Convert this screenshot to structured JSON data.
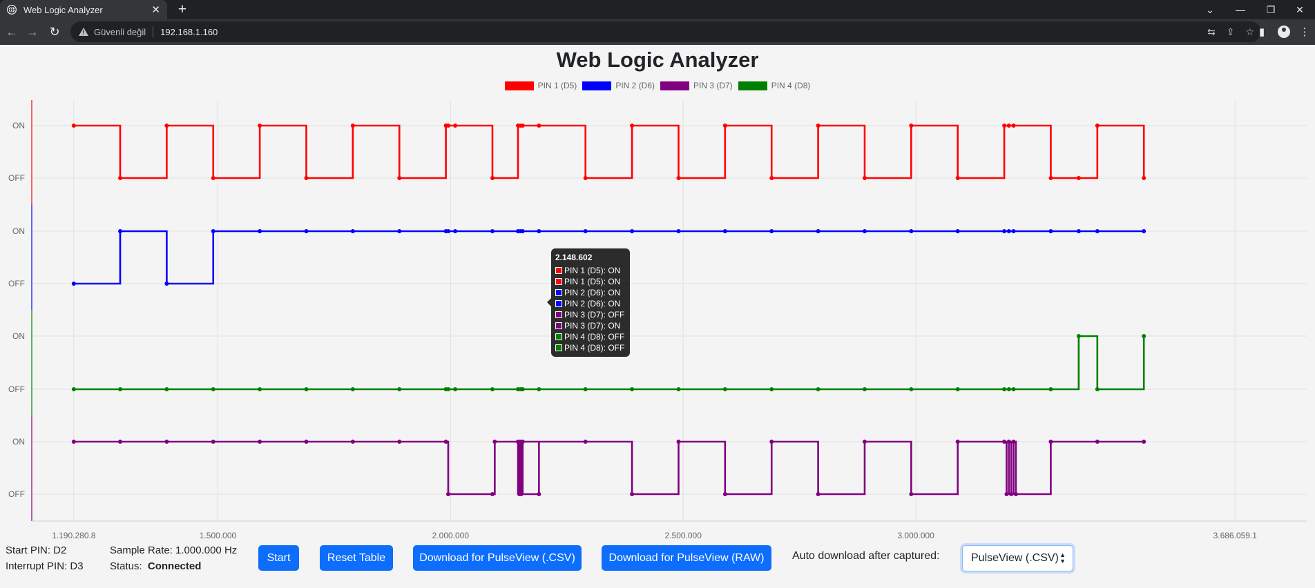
{
  "browser": {
    "tab_title": "Web Logic Analyzer",
    "not_secure_label": "Güvenli değil",
    "url": "192.168.1.160"
  },
  "page": {
    "title": "Web Logic Analyzer"
  },
  "legend": [
    {
      "label": "PIN 1 (D5)",
      "color": "#ff0000"
    },
    {
      "label": "PIN 2 (D6)",
      "color": "#0000ff"
    },
    {
      "label": "PIN 3 (D7)",
      "color": "#800080"
    },
    {
      "label": "PIN 4 (D8)",
      "color": "#008000"
    }
  ],
  "chart_data": {
    "type": "line",
    "stepped": true,
    "grid": true,
    "x_domain": [
      1100000,
      3840000
    ],
    "x_ticks": [
      {
        "value": 1190280.8,
        "label": "1.190.280,8"
      },
      {
        "value": 1500000,
        "label": "1.500.000"
      },
      {
        "value": 2000000,
        "label": "2.000.000"
      },
      {
        "value": 2500000,
        "label": "2.500.000"
      },
      {
        "value": 3000000,
        "label": "3.000.000"
      },
      {
        "value": 3686059.1,
        "label": "3.686.059,1"
      }
    ],
    "y_labels": [
      "ON",
      "OFF",
      "ON",
      "OFF",
      "ON",
      "OFF",
      "ON",
      "OFF"
    ],
    "series": [
      {
        "name": "PIN 1 (D5)",
        "color": "#ff0000",
        "lane": 0,
        "x": [
          1190281,
          1290000,
          1390000,
          1490000,
          1590000,
          1690000,
          1790000,
          1890000,
          1990000,
          1995000,
          2010000,
          2090000,
          2145000,
          2150000,
          2155000,
          2190000,
          2290000,
          2390000,
          2490000,
          2590000,
          2690000,
          2790000,
          2890000,
          2990000,
          3090000,
          3190000,
          3200000,
          3210000,
          3290000,
          3350000,
          3390000,
          3490000
        ],
        "y": [
          1,
          0,
          1,
          0,
          1,
          0,
          1,
          0,
          1,
          1,
          1,
          0,
          1,
          1,
          1,
          1,
          0,
          1,
          0,
          1,
          0,
          1,
          0,
          1,
          0,
          1,
          1,
          1,
          0,
          0,
          1,
          0
        ]
      },
      {
        "name": "PIN 2 (D6)",
        "color": "#0000ff",
        "lane": 1,
        "x": [
          1190281,
          1290000,
          1390000,
          1490000,
          1590000,
          1690000,
          1790000,
          1890000,
          1990000,
          1995000,
          2010000,
          2090000,
          2145000,
          2150000,
          2155000,
          2190000,
          2290000,
          2390000,
          2490000,
          2590000,
          2690000,
          2790000,
          2890000,
          2990000,
          3090000,
          3190000,
          3200000,
          3210000,
          3290000,
          3350000,
          3390000,
          3490000
        ],
        "y": [
          0,
          1,
          0,
          1,
          1,
          1,
          1,
          1,
          1,
          1,
          1,
          1,
          1,
          1,
          1,
          1,
          1,
          1,
          1,
          1,
          1,
          1,
          1,
          1,
          1,
          1,
          1,
          1,
          1,
          1,
          1,
          1
        ]
      },
      {
        "name": "PIN 4 (D8)",
        "color": "#008000",
        "lane": 2,
        "x": [
          1190281,
          1290000,
          1390000,
          1490000,
          1590000,
          1690000,
          1790000,
          1890000,
          1990000,
          1995000,
          2010000,
          2090000,
          2145000,
          2150000,
          2155000,
          2190000,
          2290000,
          2390000,
          2490000,
          2590000,
          2690000,
          2790000,
          2890000,
          2990000,
          3090000,
          3190000,
          3200000,
          3210000,
          3290000,
          3350000,
          3390000,
          3490000
        ],
        "y": [
          0,
          0,
          0,
          0,
          0,
          0,
          0,
          0,
          0,
          0,
          0,
          0,
          0,
          0,
          0,
          0,
          0,
          0,
          0,
          0,
          0,
          0,
          0,
          0,
          0,
          0,
          0,
          0,
          0,
          1,
          0,
          1
        ]
      },
      {
        "name": "PIN 3 (D7)",
        "color": "#800080",
        "lane": 3,
        "x": [
          1190281,
          1290000,
          1390000,
          1490000,
          1590000,
          1690000,
          1790000,
          1890000,
          1990000,
          1995000,
          2090000,
          2095000,
          2190000,
          2145000,
          2148000,
          2150000,
          2152000,
          2155000,
          2290000,
          2390000,
          2490000,
          2590000,
          2690000,
          2790000,
          2890000,
          2990000,
          3090000,
          3190000,
          3195000,
          3200000,
          3205000,
          3210000,
          3215000,
          3290000,
          3390000,
          3490000
        ],
        "y": [
          1,
          1,
          1,
          1,
          1,
          1,
          1,
          1,
          1,
          0,
          0,
          1,
          0,
          1,
          0,
          1,
          0,
          1,
          1,
          0,
          1,
          0,
          1,
          0,
          1,
          0,
          1,
          1,
          0,
          1,
          0,
          1,
          0,
          1,
          1,
          1
        ]
      }
    ]
  },
  "tooltip": {
    "title": "2.148.602",
    "rows": [
      {
        "label": "PIN 1 (D5): ON",
        "color": "#ff0000"
      },
      {
        "label": "PIN 1 (D5): ON",
        "color": "#ff0000"
      },
      {
        "label": "PIN 2 (D6): ON",
        "color": "#0000ff"
      },
      {
        "label": "PIN 2 (D6): ON",
        "color": "#0000ff"
      },
      {
        "label": "PIN 3 (D7): OFF",
        "color": "#800080"
      },
      {
        "label": "PIN 3 (D7): ON",
        "color": "#800080"
      },
      {
        "label": "PIN 4 (D8): OFF",
        "color": "#008000"
      },
      {
        "label": "PIN 4 (D8): OFF",
        "color": "#008000"
      }
    ]
  },
  "info": {
    "start_pin": "Start PIN: D2",
    "interrupt_pin": "Interrupt PIN: D3",
    "sample_rate": "Sample Rate: 1.000.000 Hz",
    "status_label": "Status:",
    "status_value": "Connected"
  },
  "controls": {
    "start": "Start",
    "reset": "Reset Table",
    "download_csv": "Download for PulseView (.CSV)",
    "download_raw": "Download for PulseView (RAW)",
    "auto_label": "Auto download after captured:",
    "auto_value": "PulseView (.CSV)"
  }
}
